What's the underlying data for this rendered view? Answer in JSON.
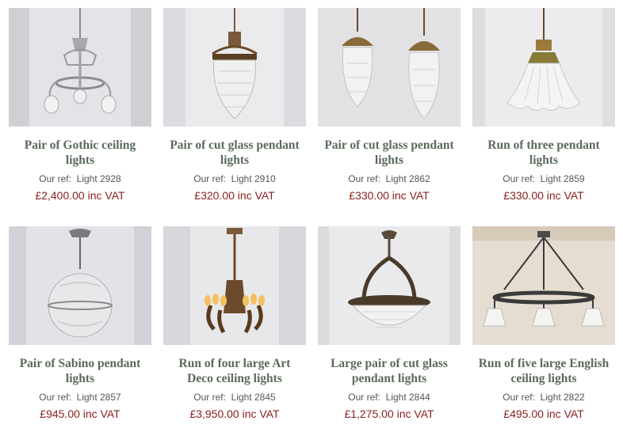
{
  "products": [
    {
      "title": "Pair of Gothic ceiling lights",
      "ref_label": "Our ref:",
      "ref": "Light 2928",
      "price": "£2,400.00 inc VAT",
      "image": "gothic-chandelier",
      "bg": "#cfcfd4"
    },
    {
      "title": "Pair of cut glass pendant lights",
      "ref_label": "Our ref:",
      "ref": "Light 2910",
      "price": "£320.00 inc VAT",
      "image": "cut-glass-pendant",
      "bg": "#dcdce0"
    },
    {
      "title": "Pair of cut glass pendant lights",
      "ref_label": "Our ref:",
      "ref": "Light 2862",
      "price": "£330.00 inc VAT",
      "image": "two-cut-glass-pendants",
      "bg": "#e2e2e4"
    },
    {
      "title": "Run of three pendant lights",
      "ref_label": "Our ref:",
      "ref": "Light 2859",
      "price": "£330.00 inc VAT",
      "image": "holophane-shade",
      "bg": "#dedee0"
    },
    {
      "title": "Pair of Sabino pendant lights",
      "ref_label": "Our ref:",
      "ref": "Light 2857",
      "price": "£945.00 inc VAT",
      "image": "sabino-globe",
      "bg": "#d2d3d8"
    },
    {
      "title": "Run of four large Art Deco ceiling lights",
      "ref_label": "Our ref:",
      "ref": "Light 2845",
      "price": "£3,950.00 inc VAT",
      "image": "art-deco-chandelier",
      "bg": "#d8d8dc"
    },
    {
      "title": "Large pair of cut glass pendant lights",
      "ref_label": "Our ref:",
      "ref": "Light 2844",
      "price": "£1,275.00 inc VAT",
      "image": "bowl-pendant",
      "bg": "#dcdcdf"
    },
    {
      "title": "Run of five large English ceiling lights",
      "ref_label": "Our ref:",
      "ref": "Light 2822",
      "price": "£495.00 inc VAT",
      "image": "hoop-chandelier",
      "bg": "#e6ddd2"
    }
  ]
}
